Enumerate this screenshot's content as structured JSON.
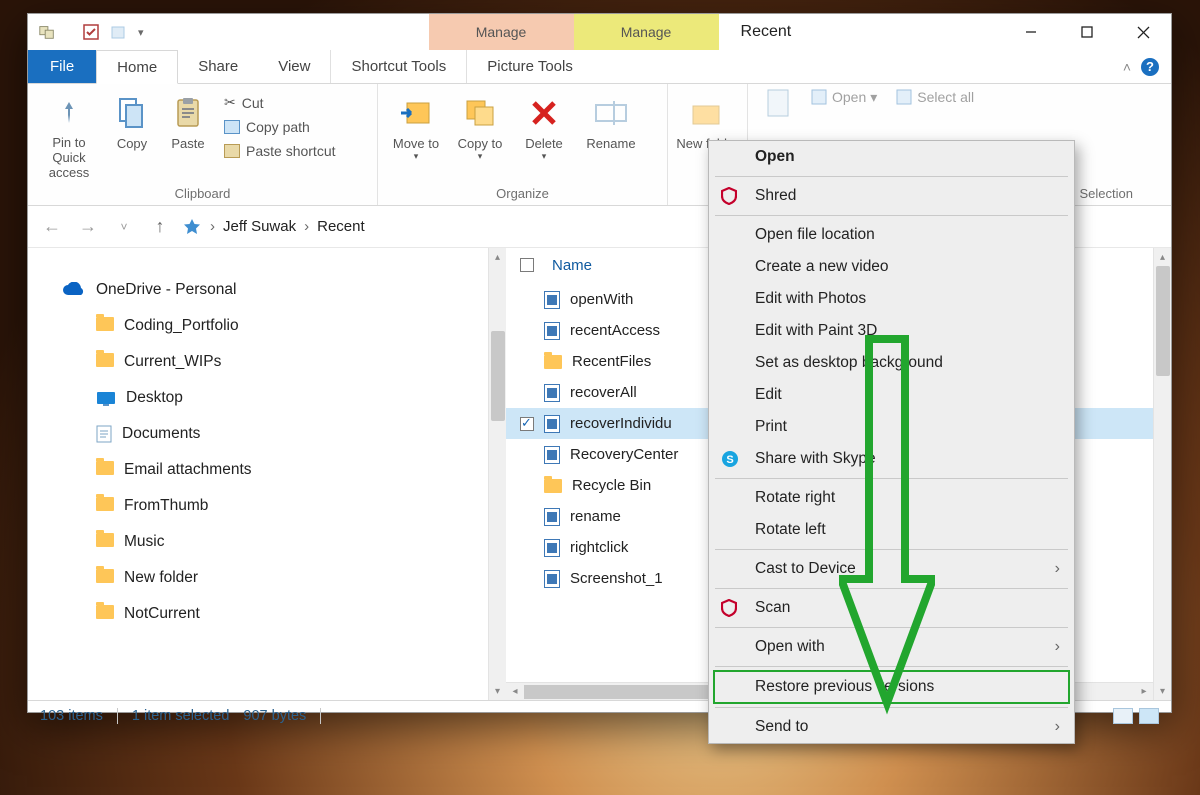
{
  "window": {
    "title": "Recent",
    "context_tabs": [
      {
        "label": "Manage",
        "sub": "Shortcut Tools"
      },
      {
        "label": "Manage",
        "sub": "Picture Tools"
      }
    ],
    "tabs": {
      "file": "File",
      "home": "Home",
      "share": "Share",
      "view": "View"
    }
  },
  "ribbon": {
    "pin": "Pin to Quick access",
    "copy": "Copy",
    "paste": "Paste",
    "cut": "Cut",
    "copy_path": "Copy path",
    "paste_shortcut": "Paste shortcut",
    "clipboard_label": "Clipboard",
    "move_to": "Move to",
    "copy_to": "Copy to",
    "delete": "Delete",
    "rename": "Rename",
    "organize_label": "Organize",
    "new_folder": "New folder",
    "open": "Open",
    "select_all": "Select all",
    "selection": "Selection"
  },
  "breadcrumb": {
    "user": "Jeff Suwak",
    "folder": "Recent"
  },
  "tree": {
    "root": "OneDrive - Personal",
    "items": [
      "Coding_Portfolio",
      "Current_WIPs",
      "Desktop",
      "Documents",
      "Email attachments",
      "FromThumb",
      "Music",
      "New folder",
      "NotCurrent"
    ]
  },
  "filelist": {
    "header": "Name",
    "items": [
      {
        "name": "openWith",
        "type": "doc"
      },
      {
        "name": "recentAccess",
        "type": "doc"
      },
      {
        "name": "RecentFiles",
        "type": "folder"
      },
      {
        "name": "recoverAll",
        "type": "doc"
      },
      {
        "name": "recoverIndividu",
        "type": "doc",
        "selected": true
      },
      {
        "name": "RecoveryCenter",
        "type": "doc"
      },
      {
        "name": "Recycle Bin",
        "type": "folder"
      },
      {
        "name": "rename",
        "type": "doc"
      },
      {
        "name": "rightclick",
        "type": "doc"
      },
      {
        "name": "Screenshot_1",
        "type": "doc"
      }
    ]
  },
  "status": {
    "count": "103 items",
    "selected": "1 item selected",
    "size": "907 bytes"
  },
  "context_menu": {
    "open": "Open",
    "shred": "Shred",
    "open_loc": "Open file location",
    "create_video": "Create a new video",
    "edit_photos": "Edit with Photos",
    "edit_paint3d": "Edit with Paint 3D",
    "set_bg": "Set as desktop background",
    "edit": "Edit",
    "print": "Print",
    "share_skype": "Share with Skype",
    "rot_r": "Rotate right",
    "rot_l": "Rotate left",
    "cast": "Cast to Device",
    "scan": "Scan",
    "open_with": "Open with",
    "restore": "Restore previous versions",
    "send_to": "Send to"
  }
}
